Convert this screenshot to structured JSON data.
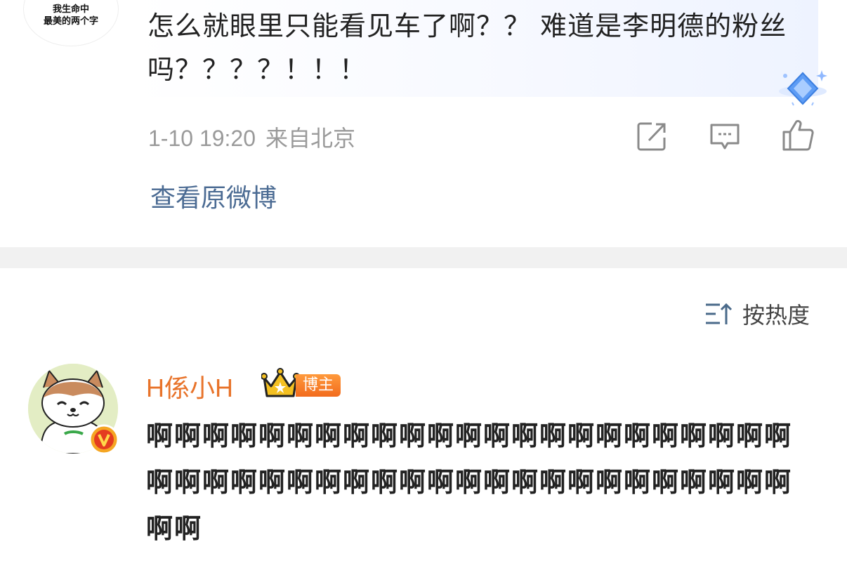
{
  "prev_comment": {
    "avatar_text": "我生命中\n最美的两个字",
    "text": "怎么就眼里只能看见车了啊？？ 难道是李明德的粉丝吗？？？？！！！",
    "time": "1-10 19:20",
    "location": "来自北京",
    "actions": {
      "repost_icon": "share-icon",
      "comment_icon": "comment-icon",
      "like_icon": "thumbs-up-icon"
    },
    "view_original_label": "查看原微博"
  },
  "sort": {
    "label": "按热度",
    "icon": "sort-icon"
  },
  "reply": {
    "username": "H係小H",
    "badge": "博主",
    "verified_icon": "v-badge-icon",
    "text": "啊啊啊啊啊啊啊啊啊啊啊啊啊啊啊啊啊啊啊啊啊啊啊啊啊啊啊啊啊啊啊啊啊啊啊啊啊啊啊啊啊啊啊啊啊啊啊啊"
  },
  "colors": {
    "username": "#e8732a",
    "link": "#4b6b93",
    "meta": "#9a9a9a",
    "divider": "#f1f1f1"
  }
}
